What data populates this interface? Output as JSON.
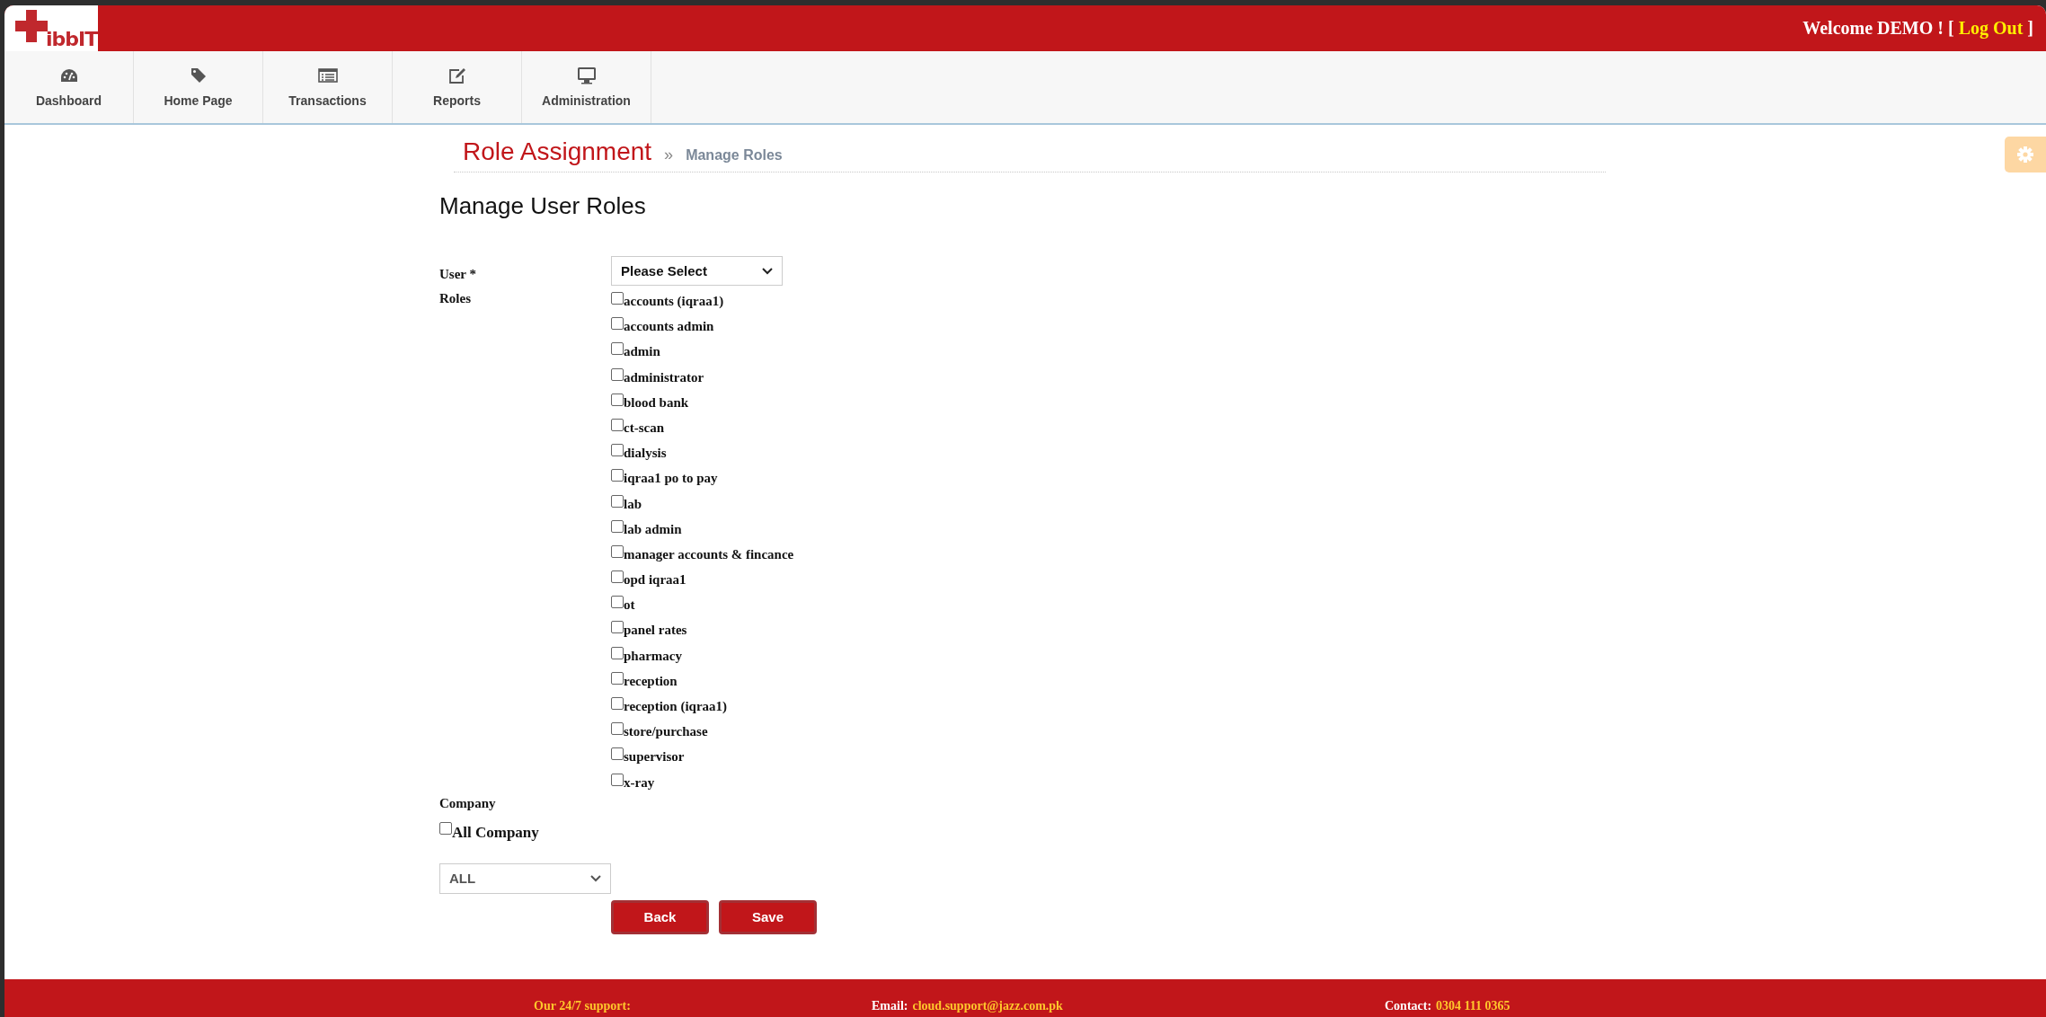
{
  "header": {
    "logo_text": "ibbIT",
    "welcome": "Welcome DEMO !",
    "bracket_open": "[",
    "logout": "Log Out",
    "bracket_close": "]"
  },
  "nav": [
    {
      "label": "Dashboard"
    },
    {
      "label": "Home Page"
    },
    {
      "label": "Transactions"
    },
    {
      "label": "Reports"
    },
    {
      "label": "Administration"
    }
  ],
  "breadcrumb": {
    "title": "Role Assignment",
    "separator": "»",
    "current": "Manage Roles"
  },
  "page_title": "Manage User Roles",
  "form": {
    "user_label": "User *",
    "user_select": "Please Select",
    "roles_label": "Roles",
    "roles": [
      {
        "label": "accounts (iqraa1)",
        "checked": false
      },
      {
        "label": "accounts admin",
        "checked": false
      },
      {
        "label": "admin",
        "checked": false
      },
      {
        "label": "administrator",
        "checked": false
      },
      {
        "label": "blood bank",
        "checked": false
      },
      {
        "label": "ct-scan",
        "checked": false
      },
      {
        "label": "dialysis",
        "checked": false
      },
      {
        "label": "iqraa1 po to pay",
        "checked": false
      },
      {
        "label": "lab",
        "checked": false
      },
      {
        "label": "lab admin",
        "checked": false
      },
      {
        "label": "manager accounts & fincance",
        "checked": false
      },
      {
        "label": "opd iqraa1",
        "checked": false
      },
      {
        "label": "ot",
        "checked": false
      },
      {
        "label": "panel rates",
        "checked": false
      },
      {
        "label": "pharmacy",
        "checked": false
      },
      {
        "label": "reception",
        "checked": false
      },
      {
        "label": "reception (iqraa1)",
        "checked": false
      },
      {
        "label": "store/purchase",
        "checked": false
      },
      {
        "label": "supervisor",
        "checked": false
      },
      {
        "label": "x-ray",
        "checked": false
      }
    ],
    "company_label": "Company",
    "all_company": {
      "label": "All Company",
      "checked": false
    },
    "company_select": "ALL",
    "buttons": [
      "Back",
      "Save"
    ]
  },
  "footer": {
    "support_label": "Our 24/7 support:",
    "email_label": "Email:",
    "email": "cloud.support@jazz.com.pk",
    "contact_label": "Contact:",
    "contact": "0304 111 0365"
  }
}
